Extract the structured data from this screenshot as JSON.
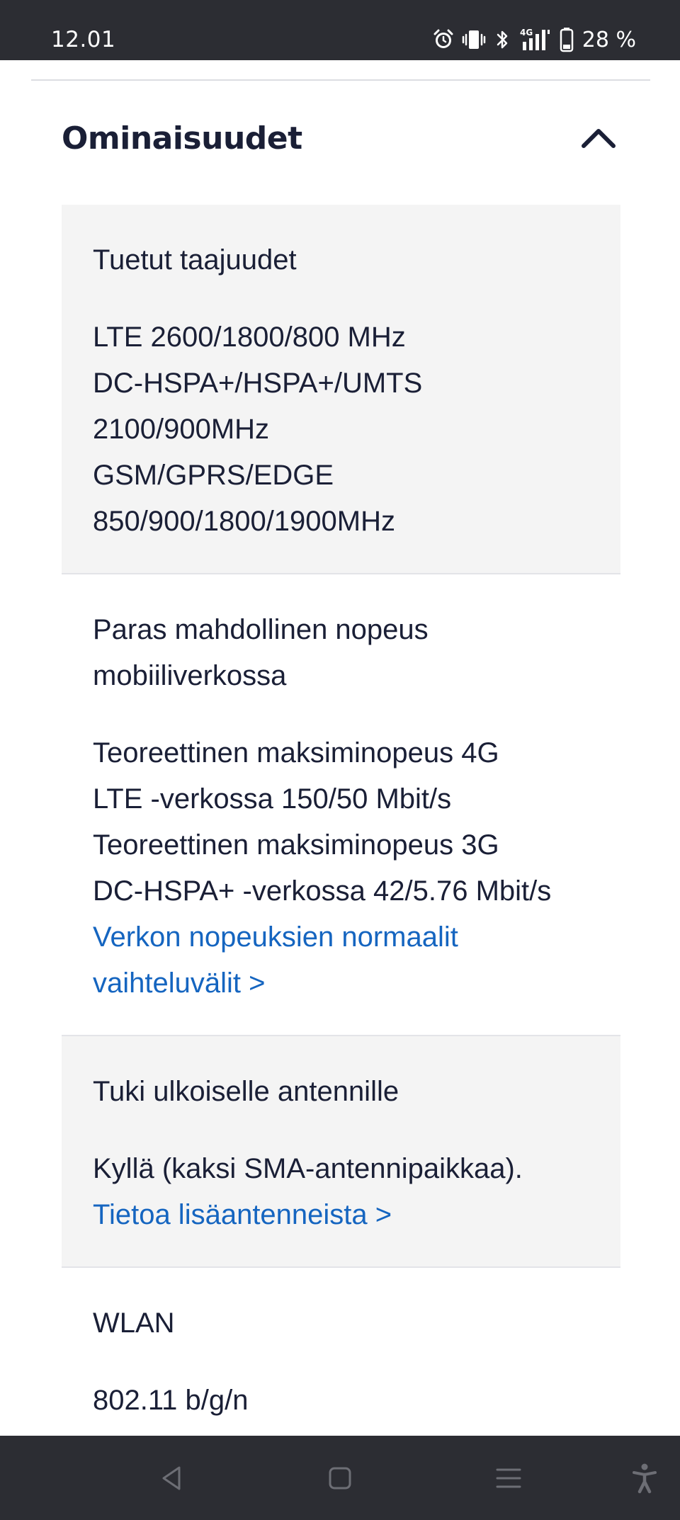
{
  "status_bar": {
    "time": "12.01",
    "battery": "28 %",
    "icons": [
      "alarm-icon",
      "vibrate-icon",
      "bluetooth-icon",
      "4g-signal-icon",
      "battery-icon"
    ]
  },
  "section": {
    "title": "Ominaisuudet",
    "toggle_icon": "chevron-up-icon"
  },
  "specs": [
    {
      "label": "Tuetut taajuudet",
      "value": "LTE 2600/1800/800 MHz\nDC-HSPA+/HSPA+/UMTS\n2100/900MHz\nGSM/GPRS/EDGE\n850/900/1800/1900MHz"
    },
    {
      "label": "Paras mahdollinen nopeus\nmobiiliverkossa",
      "value": "Teoreettinen maksiminopeus 4G\nLTE -verkossa 150/50 Mbit/s\nTeoreettinen maksiminopeus 3G\nDC-HSPA+ -verkossa 42/5.76 Mbit/s",
      "link": "Verkon nopeuksien normaalit\nvaihteluvälit >"
    },
    {
      "label": "Tuki ulkoiselle antennille",
      "value": "Kyllä (kaksi SMA-antennipaikkaa).",
      "link": "Tietoa lisäantenneista >"
    },
    {
      "label": "WLAN",
      "value": "802.11 b/g/n"
    }
  ],
  "nav_bar": {
    "icons": [
      "back-icon",
      "home-icon",
      "recents-icon",
      "accessibility-icon"
    ]
  },
  "colors": {
    "text": "#1a1f36",
    "link": "#1565c0",
    "shaded_row": "#f4f4f4",
    "system_bars": "#2c2d33"
  }
}
